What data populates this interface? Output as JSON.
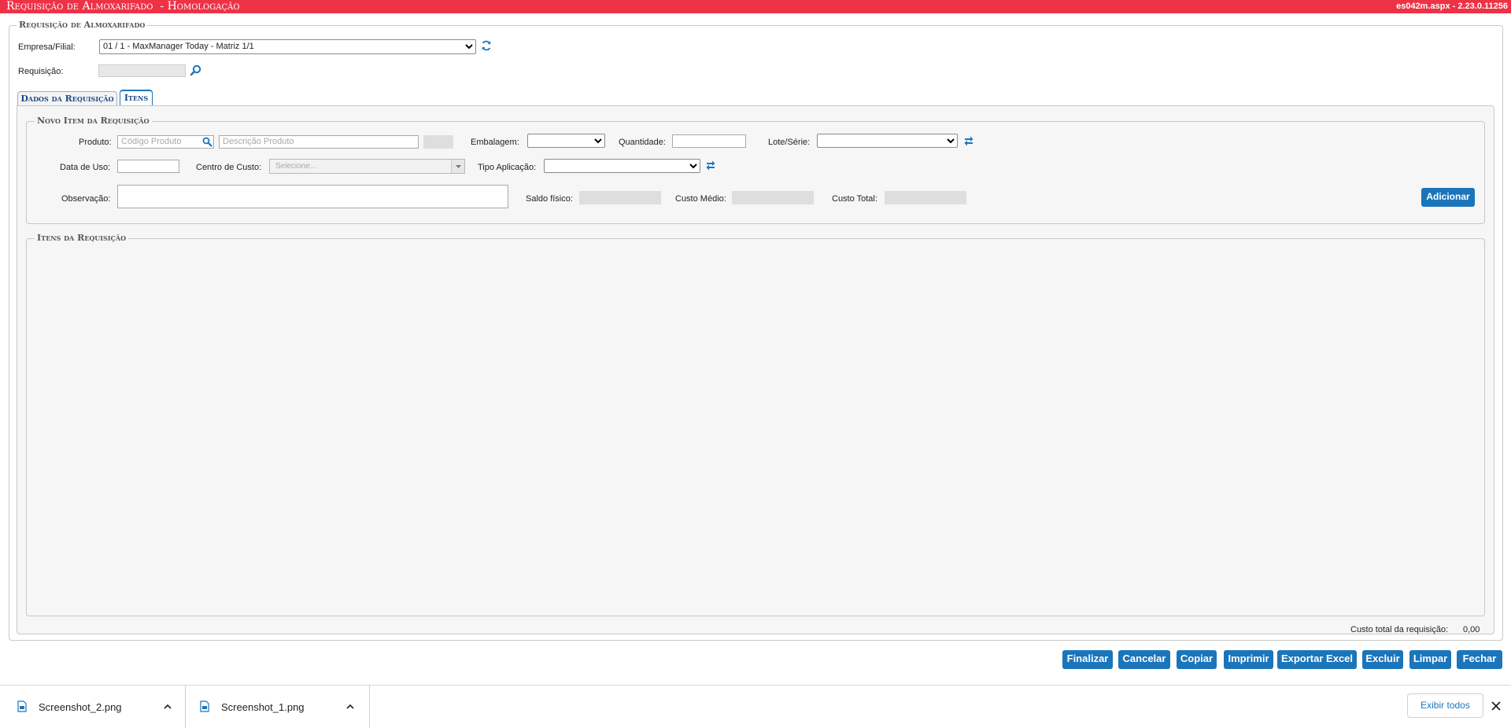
{
  "header": {
    "title": "Requisição de Almoxarifado  - Homologação",
    "version": "es042m.aspx - 2.23.0.11256"
  },
  "main": {
    "legend": "Requisição de Almoxarifado",
    "empresa_label": "Empresa/Filial:",
    "empresa_value": "01 / 1 - MaxManager Today - Matriz 1/1",
    "requisicao_label": "Requisição:",
    "requisicao_value": ""
  },
  "tabs": [
    {
      "label": "Dados da Requisição",
      "active": false
    },
    {
      "label": "Itens",
      "active": true
    }
  ],
  "novo_item": {
    "legend": "Novo Item da Requisição",
    "produto_label": "Produto:",
    "codigo_placeholder": "Código Produto",
    "descricao_placeholder": "Descrição Produto",
    "embalagem_label": "Embalagem:",
    "embalagem_value": "",
    "quantidade_label": "Quantidade:",
    "quantidade_value": "",
    "lote_label": "Lote/Série:",
    "lote_value": "",
    "data_uso_label": "Data de Uso:",
    "data_uso_value": "",
    "centro_custo_label": "Centro de Custo:",
    "centro_custo_placeholder": "Selecione...",
    "tipo_aplicacao_label": "Tipo Aplicação:",
    "tipo_aplicacao_value": "",
    "observacao_label": "Observação:",
    "observacao_value": "",
    "saldo_label": "Saldo físico:",
    "custo_medio_label": "Custo Médio:",
    "custo_total_label": "Custo Total:",
    "adicionar_label": "Adicionar"
  },
  "itens": {
    "legend": "Itens da Requisição",
    "total_label": "Custo total da requisição:",
    "total_value": "0,00"
  },
  "actions": [
    "Finalizar",
    "Cancelar",
    "Copiar",
    "Imprimir",
    "Exportar Excel",
    "Excluir",
    "Limpar",
    "Fechar"
  ],
  "downloads": {
    "items": [
      {
        "name": "Screenshot_2.png",
        "icon": "file-icon"
      },
      {
        "name": "Screenshot_1.png",
        "icon": "file-icon"
      }
    ],
    "show_all_label": "Exibir todos"
  },
  "colors": {
    "title_bar": "#ee3246",
    "button": "#1b75bb"
  }
}
